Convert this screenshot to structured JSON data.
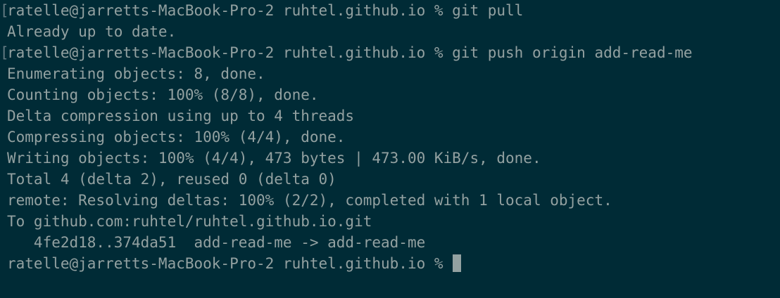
{
  "theme": {
    "background": "#002b36",
    "foreground": "#93a1a1",
    "cursor": "#93a1a1"
  },
  "session": {
    "lines": [
      {
        "mark": "[",
        "text": "ratelle@jarretts-MacBook-Pro-2 ruhtel.github.io % git pull"
      },
      {
        "mark": " ",
        "text": "Already up to date."
      },
      {
        "mark": "[",
        "text": "ratelle@jarretts-MacBook-Pro-2 ruhtel.github.io % git push origin add-read-me"
      },
      {
        "mark": " ",
        "text": "Enumerating objects: 8, done."
      },
      {
        "mark": " ",
        "text": "Counting objects: 100% (8/8), done."
      },
      {
        "mark": " ",
        "text": "Delta compression using up to 4 threads"
      },
      {
        "mark": " ",
        "text": "Compressing objects: 100% (4/4), done."
      },
      {
        "mark": " ",
        "text": "Writing objects: 100% (4/4), 473 bytes | 473.00 KiB/s, done."
      },
      {
        "mark": " ",
        "text": "Total 4 (delta 2), reused 0 (delta 0)"
      },
      {
        "mark": " ",
        "text": "remote: Resolving deltas: 100% (2/2), completed with 1 local object."
      },
      {
        "mark": " ",
        "text": "To github.com:ruhtel/ruhtel.github.io.git"
      },
      {
        "mark": " ",
        "text": "   4fe2d18..374da51  add-read-me -> add-read-me"
      }
    ],
    "prompt": "ratelle@jarretts-MacBook-Pro-2 ruhtel.github.io % "
  }
}
